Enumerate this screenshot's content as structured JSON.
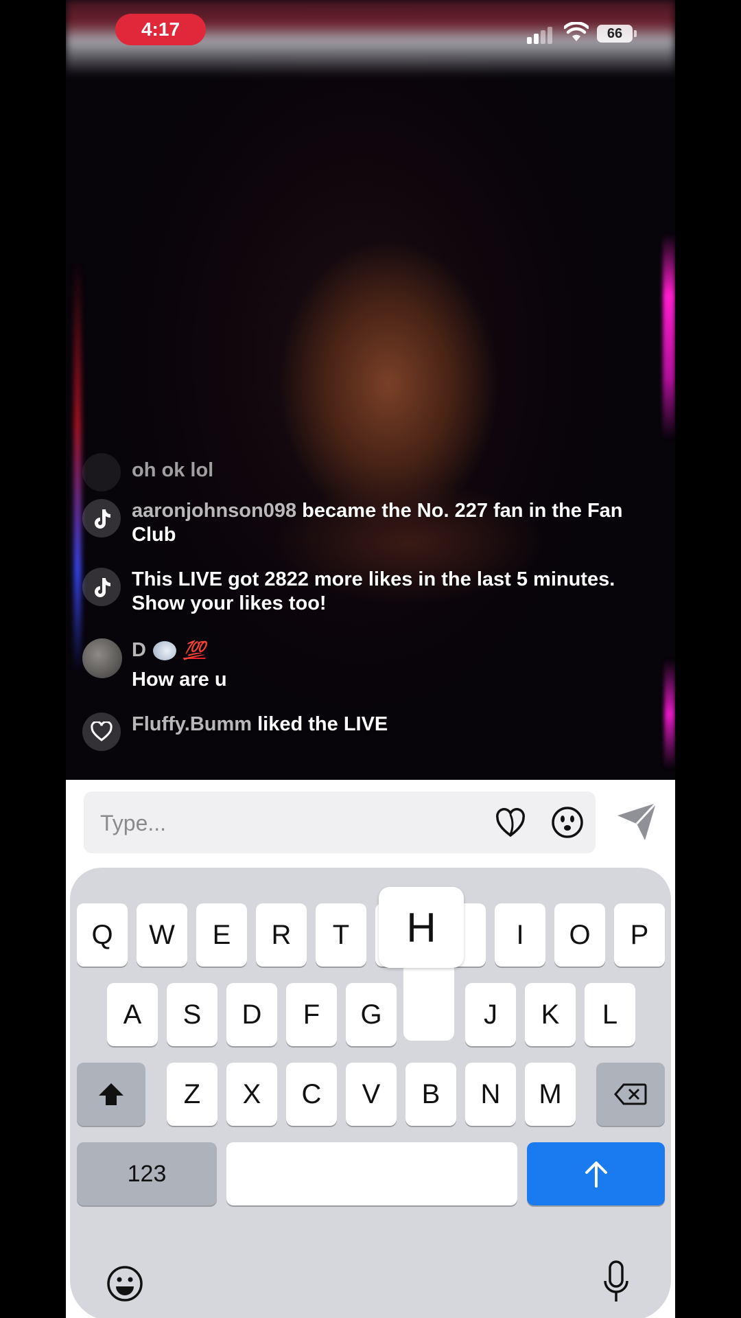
{
  "status_bar": {
    "time": "4:17",
    "battery": "66"
  },
  "chat": [
    {
      "id": "msg-1",
      "user": "",
      "text": "oh ok lol"
    },
    {
      "id": "msg-2",
      "user": "aaronjohnson098",
      "text": " became the No. 227 fan in the Fan Club"
    },
    {
      "id": "msg-3",
      "user": "",
      "text": "This LIVE got 2822 more likes in the last 5 minutes. Show your likes too!"
    },
    {
      "id": "msg-4",
      "user": "D",
      "badge": "💯",
      "text": "How are u"
    },
    {
      "id": "msg-5",
      "user": "Fluffy.Bumm",
      "text": " liked the LIVE"
    }
  ],
  "input": {
    "placeholder": "Type..."
  },
  "keyboard": {
    "popup_key": "H",
    "row1": [
      "Q",
      "W",
      "E",
      "R",
      "T",
      "I",
      "O",
      "P"
    ],
    "row2": [
      "A",
      "S",
      "D",
      "F",
      "G",
      "J",
      "K",
      "L"
    ],
    "row3": [
      "Z",
      "X",
      "C",
      "V",
      "B",
      "N",
      "M"
    ],
    "numbers_label": "123"
  },
  "icons": {
    "tiktok": "tiktok-icon",
    "heart": "heart-icon",
    "emoji": "emoji-icon",
    "send": "send-icon",
    "shift": "shift-icon",
    "backspace": "backspace-icon",
    "return": "return-arrow-icon",
    "mic": "microphone-icon"
  },
  "colors": {
    "live_red": "#e0283a",
    "return_blue": "#1a7bf0",
    "keyboard_bg": "#d5d7dc"
  }
}
